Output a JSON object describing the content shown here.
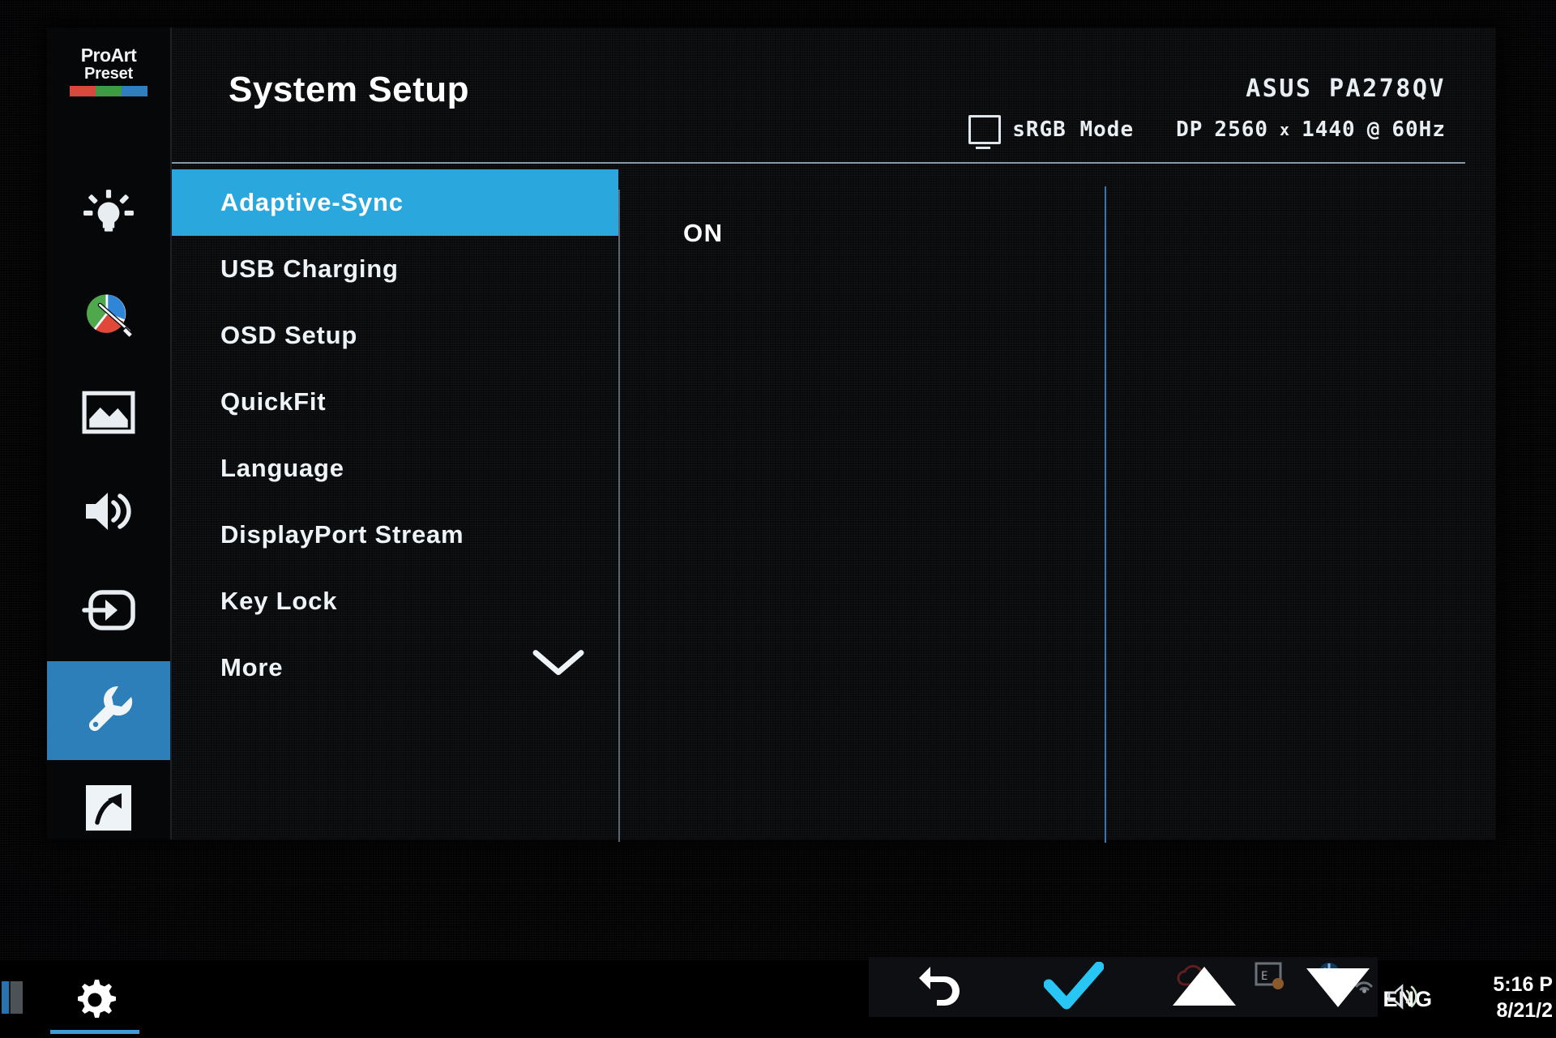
{
  "osd": {
    "brand": {
      "line1": "ProArt",
      "line2": "Preset",
      "colors": [
        "#d9483c",
        "#3f9b43",
        "#2f7fc0"
      ]
    },
    "header": {
      "title": "System Setup",
      "model": "ASUS PA278QV",
      "monitor_icon": "monitor-icon",
      "mode": "sRGB Mode",
      "source": "DP",
      "resolution_w": "2560",
      "resolution_sep": "x",
      "resolution_h": "1440",
      "at": "@",
      "refresh": "60Hz"
    },
    "rail": [
      {
        "name": "splendid-icon",
        "label": "Splendid",
        "active": false
      },
      {
        "name": "color-icon",
        "label": "Color",
        "active": false
      },
      {
        "name": "image-icon",
        "label": "Image",
        "active": false
      },
      {
        "name": "sound-icon",
        "label": "Sound",
        "active": false
      },
      {
        "name": "input-select-icon",
        "label": "Input Select",
        "active": false
      },
      {
        "name": "wrench-icon",
        "label": "System Setup",
        "active": true
      },
      {
        "name": "shortcut-icon",
        "label": "Shortcut",
        "active": false
      }
    ],
    "menu": {
      "items": [
        {
          "label": "Adaptive-Sync",
          "selected": true,
          "chevron": false
        },
        {
          "label": "USB Charging",
          "selected": false,
          "chevron": false
        },
        {
          "label": "OSD Setup",
          "selected": false,
          "chevron": false
        },
        {
          "label": "QuickFit",
          "selected": false,
          "chevron": false
        },
        {
          "label": "Language",
          "selected": false,
          "chevron": false
        },
        {
          "label": "DisplayPort Stream",
          "selected": false,
          "chevron": false
        },
        {
          "label": "Key Lock",
          "selected": false,
          "chevron": false
        },
        {
          "label": "More",
          "selected": false,
          "chevron": true
        }
      ],
      "highlight_color": "#2aa8dd"
    },
    "value": "ON",
    "controls": [
      {
        "name": "back-icon",
        "label": "Back",
        "color": "#ffffff"
      },
      {
        "name": "check-icon",
        "label": "Enter",
        "color": "#27c6f5"
      },
      {
        "name": "up-icon",
        "label": "Up",
        "color": "#ffffff"
      },
      {
        "name": "down-icon",
        "label": "Down",
        "color": "#ffffff"
      }
    ]
  },
  "taskbar": {
    "start_icon": "start-icon",
    "gear_icon": "settings-gear-icon",
    "tray": [
      {
        "name": "onedrive-icon"
      },
      {
        "name": "display-icon"
      },
      {
        "name": "bluetooth-icon"
      },
      {
        "name": "network-icon"
      },
      {
        "name": "volume-icon"
      }
    ],
    "language": "ENG",
    "time": "5:16 P",
    "date": "8/21/2"
  }
}
